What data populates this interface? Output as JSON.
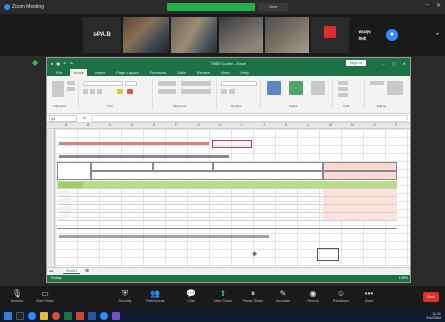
{
  "zoom": {
    "window_title": "Zoom Meeting",
    "view_button": "View",
    "participants": [
      {
        "name": "",
        "label": "oPA.B",
        "kind": "text"
      },
      {
        "name": "",
        "label": "",
        "kind": "photo"
      },
      {
        "name": "",
        "label": "",
        "kind": "photo"
      },
      {
        "name": "",
        "label": "",
        "kind": "photo"
      },
      {
        "name": "",
        "label": "",
        "kind": "photo"
      },
      {
        "name": "",
        "label": "",
        "kind": "avatar-red"
      },
      {
        "name": "",
        "label": "ทองสุข สิทธิ",
        "kind": "text"
      }
    ],
    "toolbar": [
      {
        "icon": "microphone-icon",
        "label": "Unmute"
      },
      {
        "icon": "video-camera-icon",
        "label": "Start Video"
      },
      {
        "icon": "security-icon",
        "label": "Security"
      },
      {
        "icon": "participants-icon",
        "label": "Participants"
      },
      {
        "icon": "chat-icon",
        "label": "Chat"
      },
      {
        "icon": "share-screen-icon",
        "label": "New Share"
      },
      {
        "icon": "pause-share-icon",
        "label": "Pause Share"
      },
      {
        "icon": "annotate-icon",
        "label": "Annotate"
      },
      {
        "icon": "record-icon",
        "label": "Record"
      },
      {
        "icon": "reactions-icon",
        "label": "Reactions"
      },
      {
        "icon": "more-icon",
        "label": "More"
      }
    ],
    "end_label": "End"
  },
  "excel": {
    "title": "ไฟล์งาน.xlsx  -  Excel",
    "sign_in": "Sign in",
    "tabs": [
      "File",
      "Home",
      "Insert",
      "Page Layout",
      "Formulas",
      "Data",
      "Review",
      "View",
      "Help"
    ],
    "active_tab": "Home",
    "ribbon_groups": [
      "Clipboard",
      "Font",
      "Alignment",
      "Number",
      "Styles",
      "Cells",
      "Editing"
    ],
    "name_box": "A1",
    "fx": "fx",
    "columns": [
      "A",
      "B",
      "C",
      "D",
      "E",
      "F",
      "G",
      "H",
      "I",
      "J",
      "K",
      "L",
      "M",
      "N",
      "O",
      "P"
    ],
    "note_line": "",
    "table_title": "",
    "rows": [
      "",
      "",
      "",
      "",
      "",
      "",
      ""
    ],
    "sheet_tab": "Sheet1",
    "status": "Ready",
    "zoom_pct": "100%"
  },
  "taskbar": {
    "time": "11:11",
    "date": "9/4/2564"
  },
  "colors": {
    "excel_green": "#1e7145",
    "zoom_green": "#21b34b",
    "zoom_red": "#e02e2e",
    "row_highlight": "#b7dd8a",
    "header_pink": "#fbd7d3"
  }
}
